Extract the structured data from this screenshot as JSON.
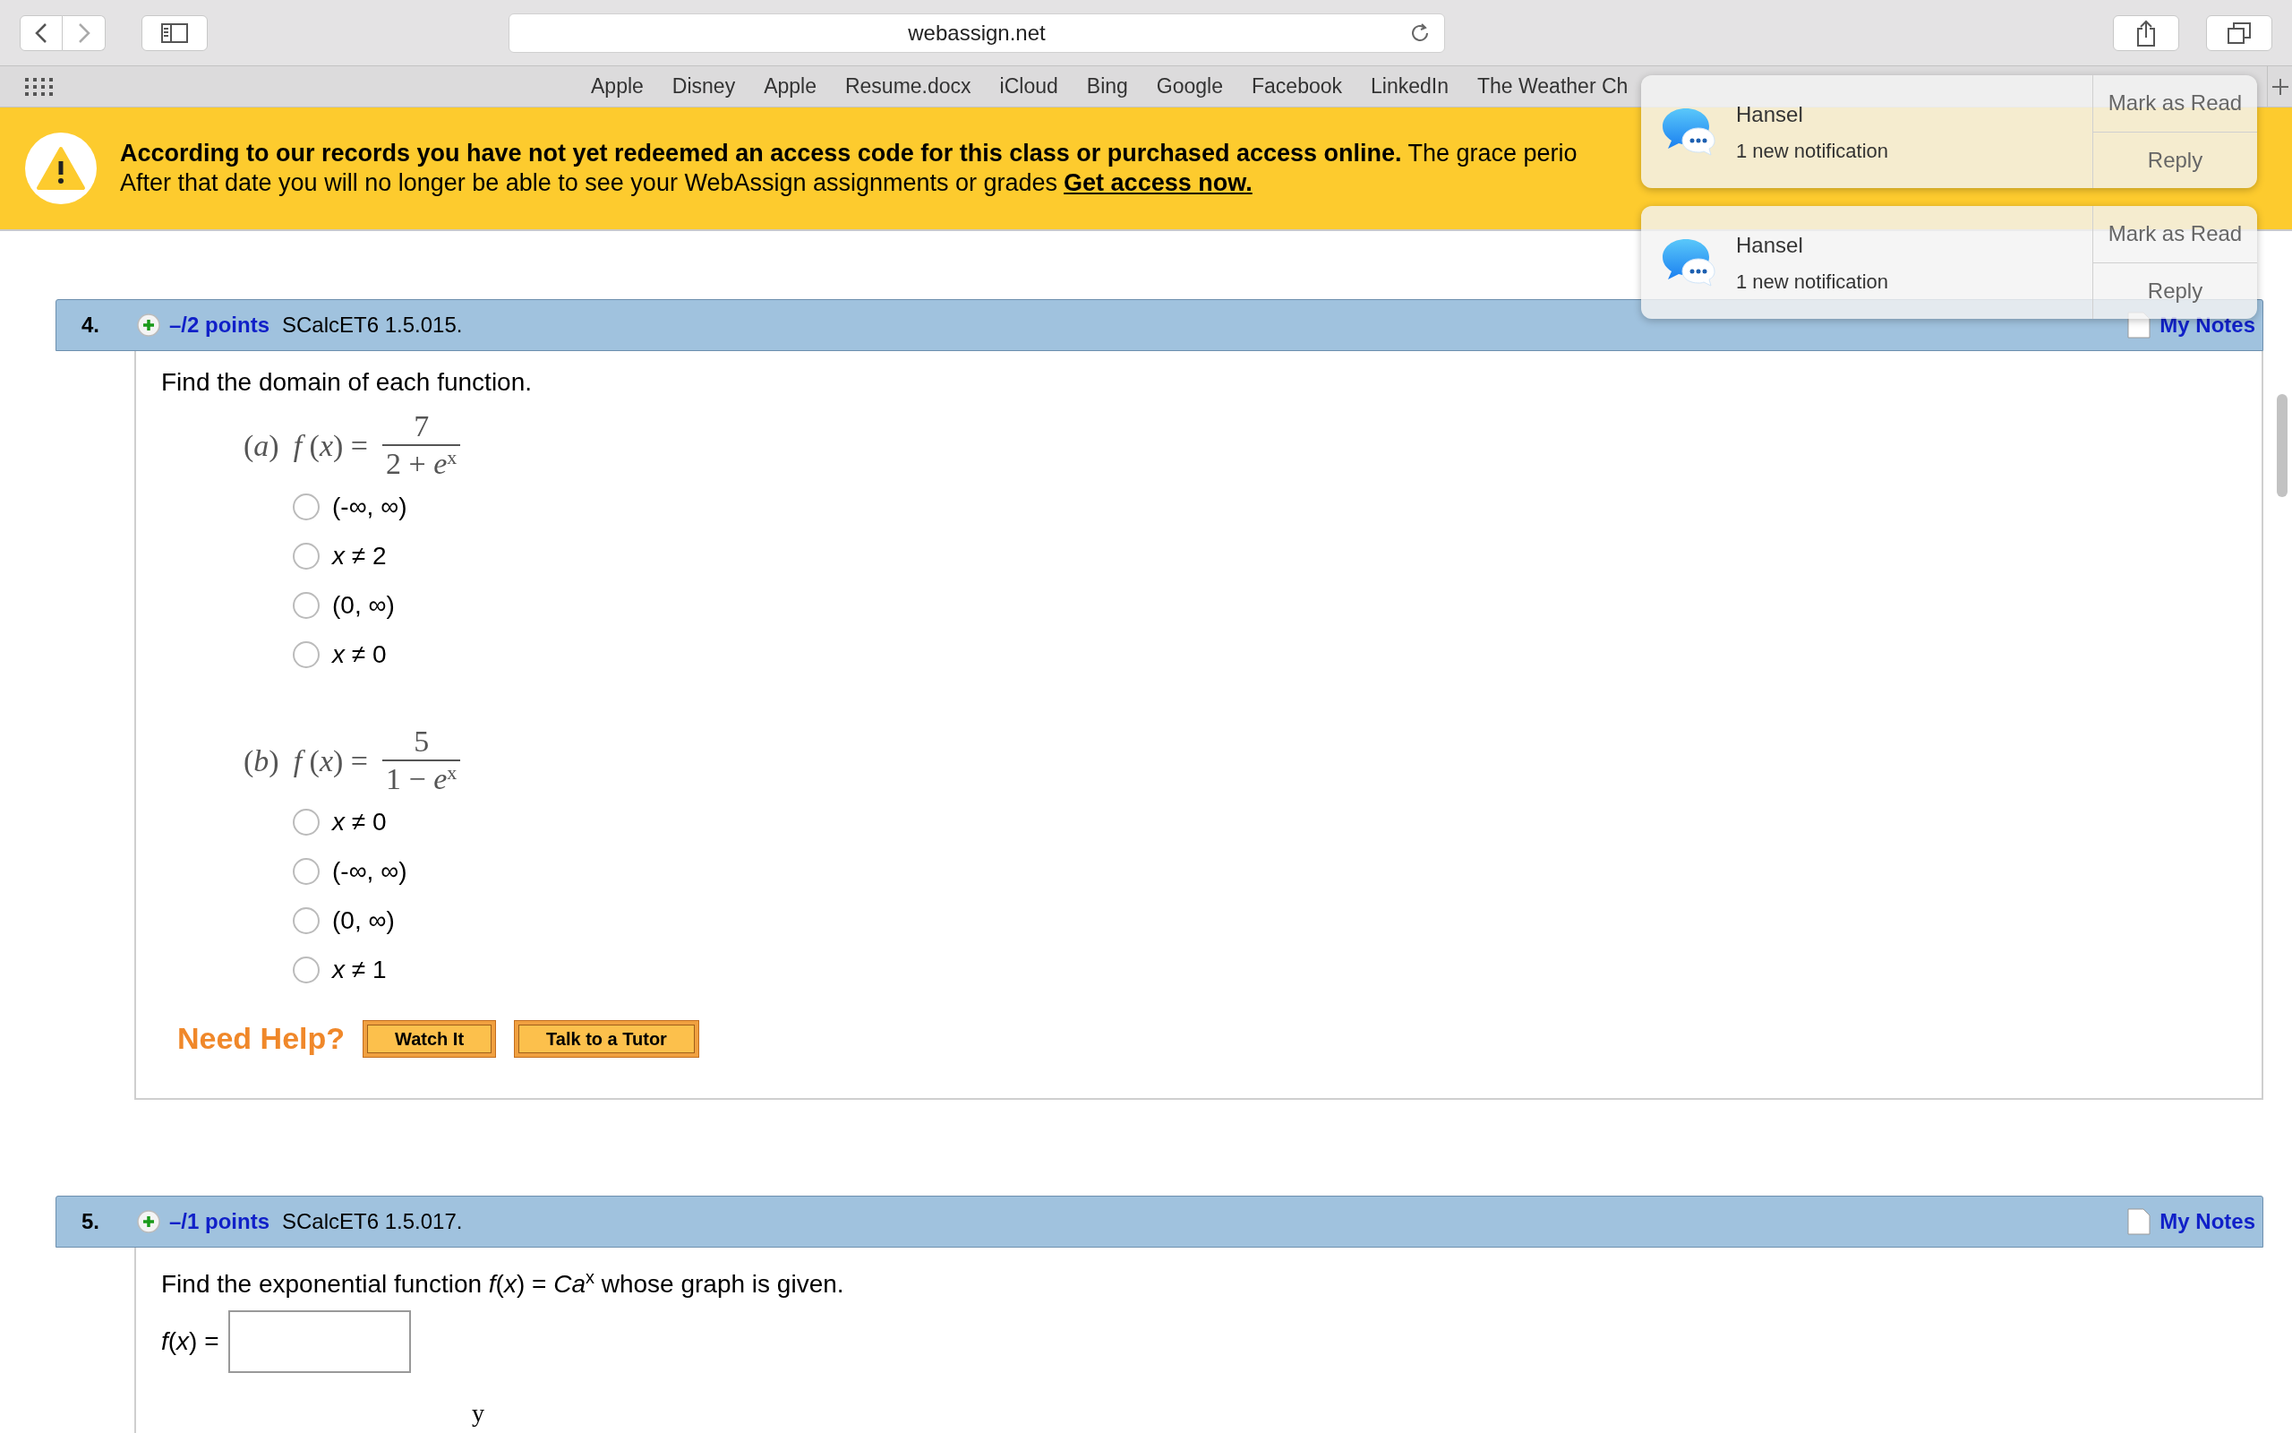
{
  "browser": {
    "address": "webassign.net",
    "bookmarks": [
      "Apple",
      "Disney",
      "Apple",
      "Resume.docx",
      "iCloud",
      "Bing",
      "Google",
      "Facebook",
      "LinkedIn",
      "The Weather Ch"
    ]
  },
  "banner": {
    "bold": "According to our records you have not yet redeemed an access code for this class or purchased access online.",
    "rest": "The grace perio",
    "line2": "After that date you will no longer be able to see your WebAssign assignments or grades",
    "link": "Get access now."
  },
  "notifications": [
    {
      "sender": "Hansel",
      "text": "1 new notification",
      "actions": [
        "Mark as Read",
        "Reply"
      ]
    },
    {
      "sender": "Hansel",
      "text": "1 new notification",
      "actions": [
        "Mark as Read",
        "Reply"
      ]
    }
  ],
  "questions": [
    {
      "number": "4.",
      "points": "–/2 points",
      "code": "SCalcET6 1.5.015.",
      "notes": "My Notes",
      "prompt": "Find the domain of each function.",
      "parts": [
        {
          "label": "(*a*)",
          "lhs": "*f* (*x*) =",
          "numerator": "7",
          "denominator": "2 + *e*$^{x}$",
          "options": [
            {
              "text": "(-∞, ∞)",
              "selected": false
            },
            {
              "text": "*x* ≠ 2",
              "selected": false
            },
            {
              "text": "(0, ∞)",
              "selected": false
            },
            {
              "text": "*x* ≠ 0",
              "selected": false
            }
          ]
        },
        {
          "label": "(*b*)",
          "lhs": "*f* (*x*) =",
          "numerator": "5",
          "denominator": "1 − *e*$^{x}$",
          "options": [
            {
              "text": "*x* ≠ 0",
              "selected": false
            },
            {
              "text": "(-∞, ∞)",
              "selected": false
            },
            {
              "text": "(0, ∞)",
              "selected": false
            },
            {
              "text": "*x* ≠ 1",
              "selected": false
            }
          ]
        }
      ],
      "help": {
        "label": "Need Help?",
        "buttons": [
          "Watch It",
          "Talk to a Tutor"
        ]
      }
    },
    {
      "number": "5.",
      "points": "–/1 points",
      "code": "SCalcET6 1.5.017.",
      "notes": "My Notes",
      "prompt": "Find the exponential function *f*(*x*) = *Ca*$^{x}$ whose graph is given.",
      "answer": {
        "label": "*f*(*x*) ="
      },
      "graph_label": "y"
    }
  ]
}
